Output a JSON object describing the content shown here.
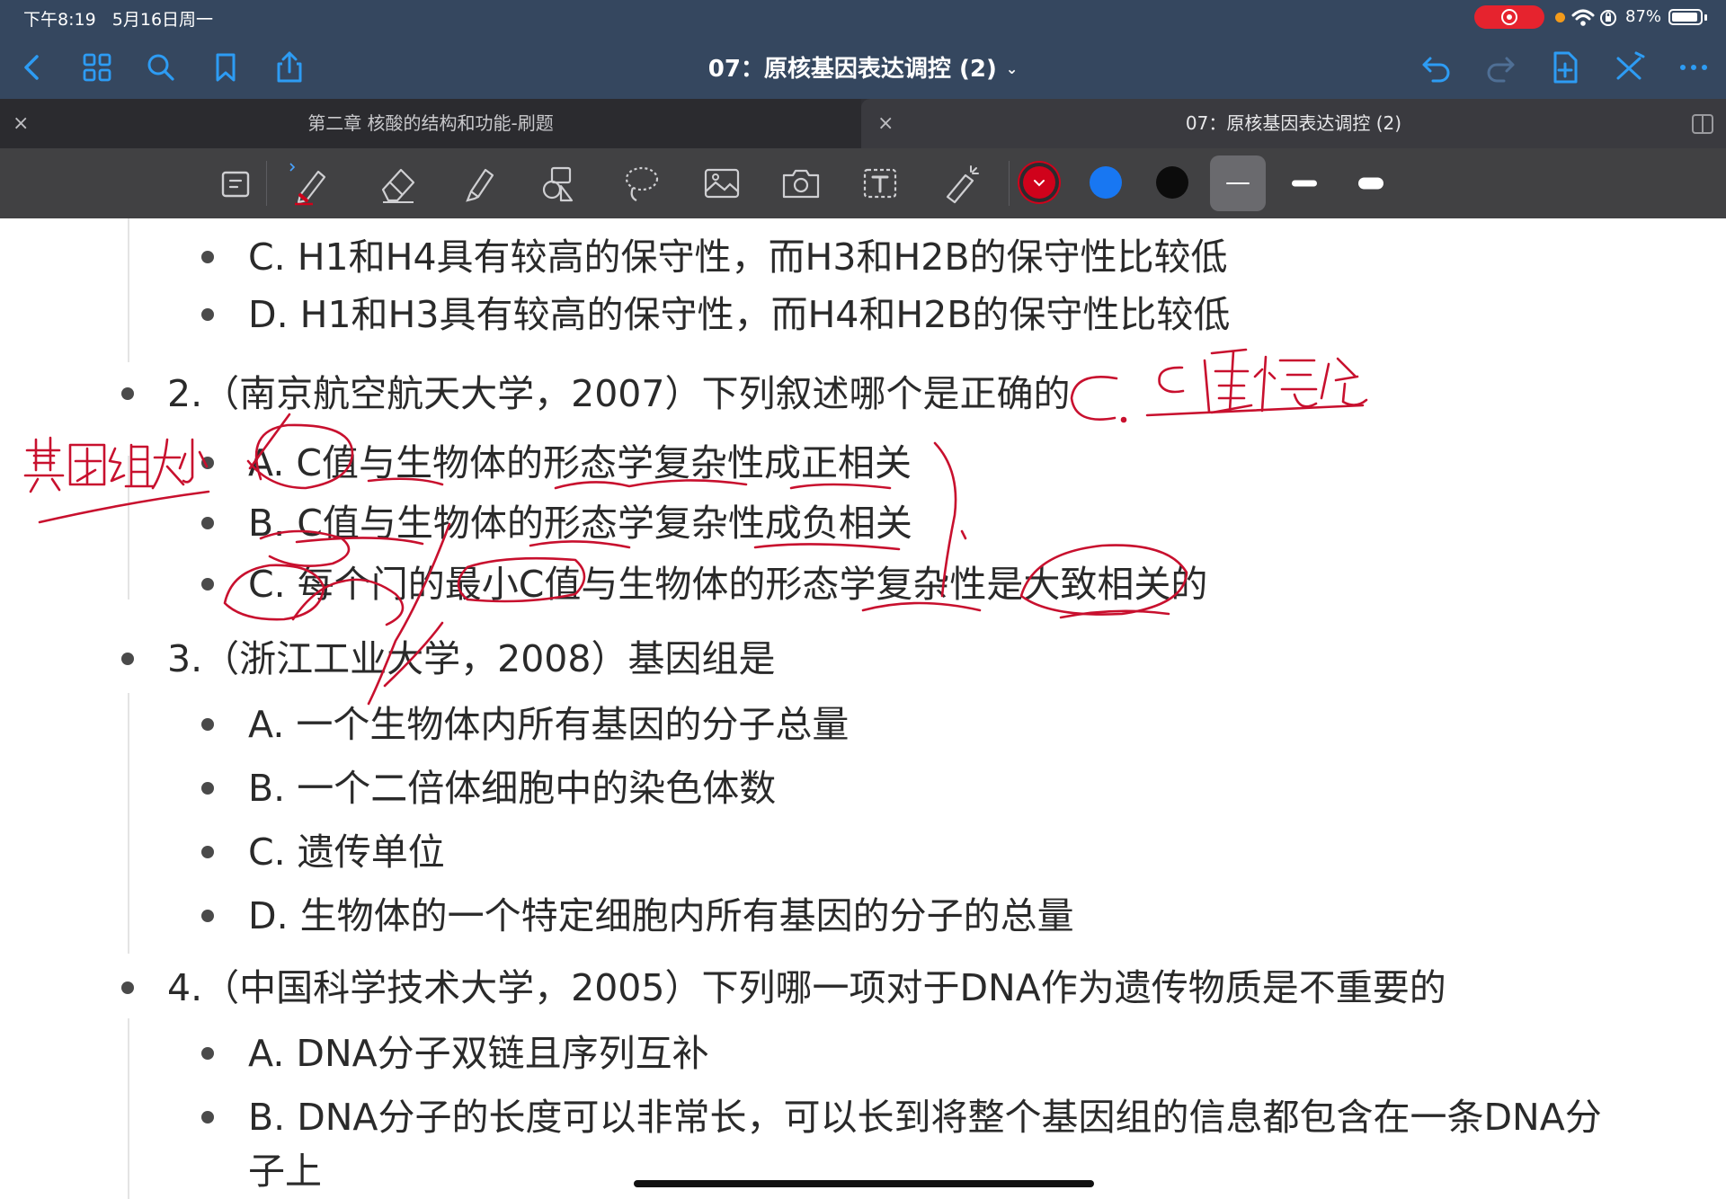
{
  "status_bar": {
    "time": "下午8:19",
    "date": "5月16日周一",
    "battery": "87%"
  },
  "nav": {
    "title": "07：原核基因表达调控 (2)",
    "chevron": "⌄"
  },
  "tabs": [
    {
      "label": "第二章 核酸的结构和功能-刷题",
      "close": "×"
    },
    {
      "label": "07：原核基因表达调控 (2)",
      "close": "×"
    }
  ],
  "colors": {
    "pen_red": "#d0021b",
    "blue": "#1877f2",
    "black": "#0c0c0c",
    "ink": "#c8102e"
  },
  "content": {
    "q1_options": [
      "C. H1和H4具有较高的保守性，而H3和H2B的保守性比较低",
      "D. H1和H3具有较高的保守性，而H4和H2B的保守性比较低"
    ],
    "q2": {
      "stem": "2.（南京航空航天大学，2007）下列叙述哪个是正确的",
      "options": [
        "A. C值与生物体的形态学复杂性成正相关",
        "B. C值与生物体的形态学复杂性成负相关",
        "C. 每个门的最小C值与生物体的形态学复杂性是大致相关的"
      ]
    },
    "q3": {
      "stem": "3.（浙江工业大学，2008）基因组是",
      "options": [
        "A. 一个生物体内所有基因的分子总量",
        "B. 一个二倍体细胞中的染色体数",
        "C. 遗传单位",
        "D. 生物体的一个特定细胞内所有基因的分子的总量"
      ]
    },
    "q4": {
      "stem": "4.（中国科学技术大学，2005）下列哪一项对于DNA作为遗传物质是不重要的",
      "options": [
        "A. DNA分子双链且序列互补",
        "B. DNA分子的长度可以非常长，可以长到将整个基因组的信息都包含在一条DNA分",
        "子上"
      ]
    }
  },
  "handwriting": {
    "answer": "C. C 值悖论",
    "margin_note": "基因组大小"
  }
}
